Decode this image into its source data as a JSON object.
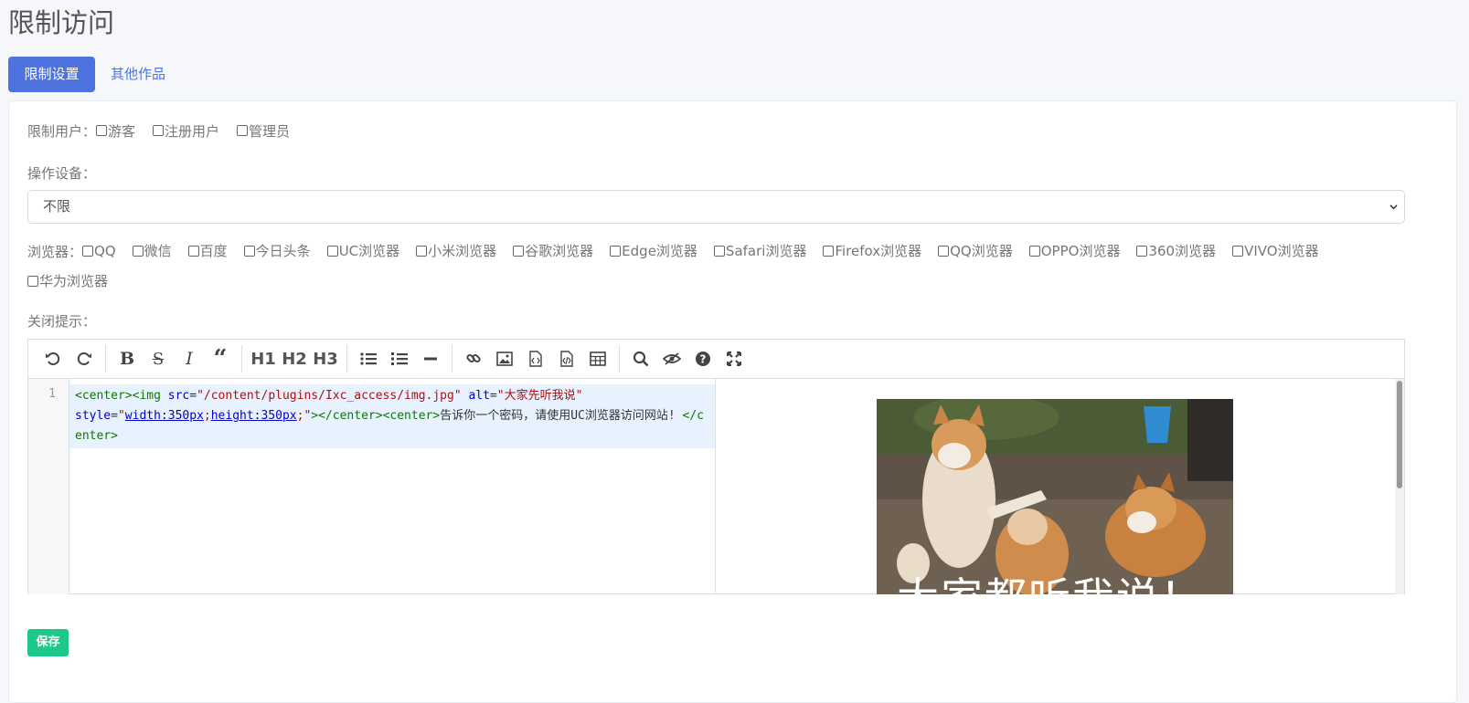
{
  "page_title": "限制访问",
  "tabs": [
    {
      "label": "限制设置",
      "active": true
    },
    {
      "label": "其他作品",
      "active": false
    }
  ],
  "restrict_users": {
    "label": "限制用户：",
    "options": [
      "游客",
      "注册用户",
      "管理员"
    ]
  },
  "device": {
    "label": "操作设备：",
    "selected": "不限"
  },
  "browsers": {
    "label": "浏览器：",
    "options": [
      "QQ",
      "微信",
      "百度",
      "今日头条",
      "UC浏览器",
      "小米浏览器",
      "谷歌浏览器",
      "Edge浏览器",
      "Safari浏览器",
      "Firefox浏览器",
      "QQ浏览器",
      "OPPO浏览器",
      "360浏览器",
      "VIVO浏览器",
      "华为浏览器"
    ]
  },
  "close_tip": {
    "label": "关闭提示：",
    "line_number": "1",
    "code": {
      "t1": "<center><img ",
      "a1": "src",
      "eq1": "=",
      "s1": "\"/content/plugins/Ixc_access/img.jpg\"",
      "a2": " alt",
      "eq2": "=",
      "s2": "\"大家先听我说\"",
      "a3": "style",
      "eq3": "=",
      "s3a": "\"",
      "s3b": "width:350px",
      "s3c": ";",
      "s3d": "height:350px",
      "s3e": ";\"",
      "t2": "></center><center>",
      "text": "告诉你一个密码，请使用UC浏览器访问网站! ",
      "t3": "</center>"
    },
    "preview_caption": "大家都听我说！"
  },
  "toolbar_text": {
    "h1": "H1",
    "h2": "H2",
    "h3": "H3"
  },
  "save_label": "保存",
  "colors": {
    "primary": "#4e73df",
    "success": "#1cc88a",
    "background": "#f5f7fb"
  }
}
